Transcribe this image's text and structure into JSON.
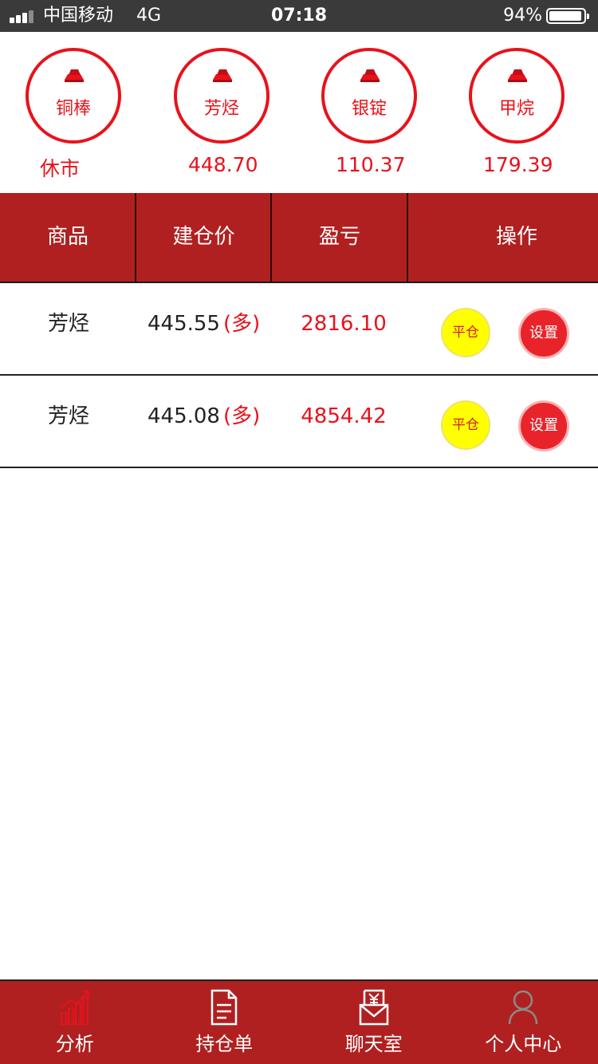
{
  "status_bar": {
    "carrier": "中国移动",
    "network": "4G",
    "time": "07:18",
    "battery": "94%"
  },
  "quotes": [
    {
      "name": "铜棒",
      "price": "休市"
    },
    {
      "name": "芳烃",
      "price": "448.70"
    },
    {
      "name": "银锭",
      "price": "110.37"
    },
    {
      "name": "甲烷",
      "price": "179.39"
    }
  ],
  "table": {
    "headers": [
      "商品",
      "建仓价",
      "盈亏",
      "操作"
    ],
    "rows": [
      {
        "product": "芳烃",
        "open_price": "445.55",
        "direction": "(多)",
        "pnl": "2816.10",
        "close_label": "平仓",
        "settings_label": "设置"
      },
      {
        "product": "芳烃",
        "open_price": "445.08",
        "direction": "(多)",
        "pnl": "4854.42",
        "close_label": "平仓",
        "settings_label": "设置"
      }
    ]
  },
  "tabbar": {
    "items": [
      {
        "label": "分析",
        "icon": "chart-icon"
      },
      {
        "label": "持仓单",
        "icon": "document-icon"
      },
      {
        "label": "聊天室",
        "icon": "yuan-chat-icon"
      },
      {
        "label": "个人中心",
        "icon": "user-icon"
      }
    ]
  },
  "colors": {
    "brand_red": "#b02020",
    "accent_red": "#e8121b",
    "close_yellow": "#ffff00"
  }
}
